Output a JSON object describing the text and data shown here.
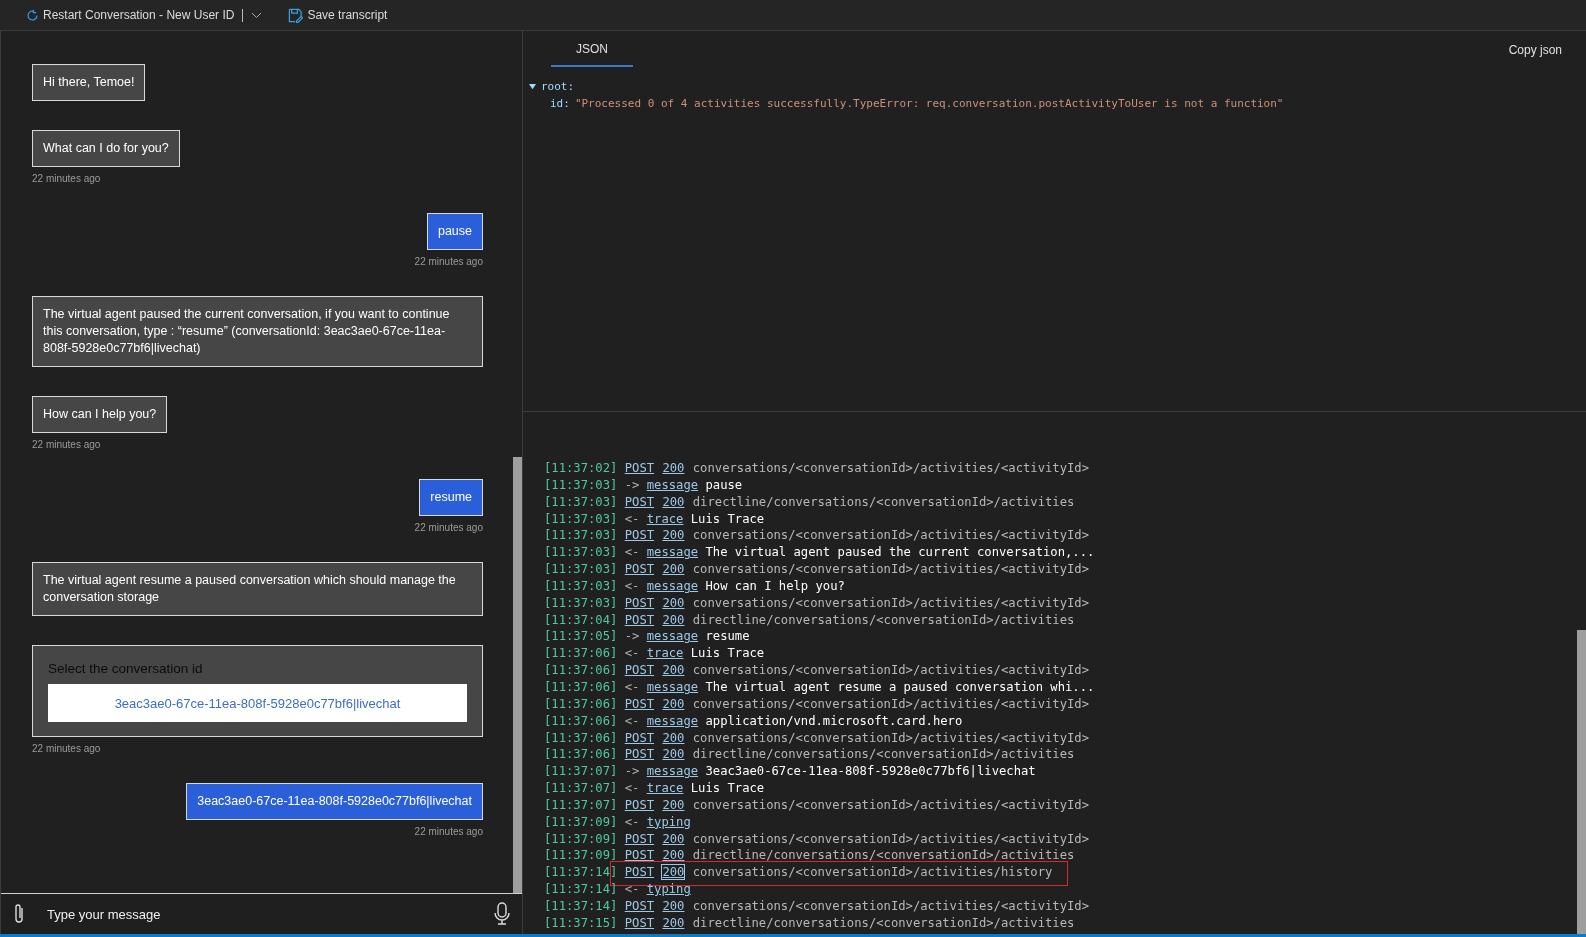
{
  "toolbar": {
    "restart_button": "Restart Conversation - New User ID",
    "save_button": "Save transcript"
  },
  "chat": {
    "messages": [
      {
        "outgoing": false,
        "kind": "text",
        "text": "Hi there, Temoe!"
      },
      {
        "outgoing": false,
        "kind": "text",
        "text": "What can I do for you?",
        "timestamp": "22 minutes ago"
      },
      {
        "outgoing": true,
        "kind": "text",
        "text": "pause",
        "timestamp": "22 minutes ago"
      },
      {
        "outgoing": false,
        "kind": "text",
        "text": "The virtual agent paused the current conversation, if you want to continue this conversation, type : “resume” (conversationId: 3eac3ae0-67ce-11ea-808f-5928e0c77bf6|livechat)"
      },
      {
        "outgoing": false,
        "kind": "text",
        "text": "How can I help you?",
        "timestamp": "22 minutes ago"
      },
      {
        "outgoing": true,
        "kind": "text",
        "text": "resume",
        "timestamp": "22 minutes ago"
      },
      {
        "outgoing": false,
        "kind": "text",
        "text": "The virtual agent resume a paused conversation which should manage the conversation storage"
      },
      {
        "outgoing": false,
        "kind": "card",
        "title": "Select the conversation id",
        "button": "3eac3ae0-67ce-11ea-808f-5928e0c77bf6|livechat",
        "timestamp": "22 minutes ago"
      },
      {
        "outgoing": true,
        "kind": "text",
        "text": "3eac3ae0-67ce-11ea-808f-5928e0c77bf6|livechat",
        "timestamp": "22 minutes ago"
      }
    ],
    "input": {
      "placeholder": "Type your message"
    }
  },
  "inspector": {
    "tabs": [
      {
        "label": "JSON",
        "selected": true
      }
    ],
    "copy_button": "Copy json",
    "tree": {
      "root_label": "root:",
      "expanded": true,
      "fields": [
        {
          "key": "id:",
          "value": "\"Processed 0 of 4 activities successfully.TypeError: req.conversation.postActivityToUser is not a function\""
        }
      ]
    }
  },
  "log": [
    {
      "kind": "post",
      "time": "[11:37:02]",
      "method": "POST",
      "status": "200",
      "path": "conversations/<conversationId>/activities/<activityId>",
      "highlighted": false
    },
    {
      "kind": "activity",
      "time": "[11:37:03]",
      "direction": "->",
      "type": "message",
      "text": "pause"
    },
    {
      "kind": "post",
      "time": "[11:37:03]",
      "method": "POST",
      "status": "200",
      "path": "directline/conversations/<conversationId>/activities",
      "highlighted": false
    },
    {
      "kind": "activity",
      "time": "[11:37:03]",
      "direction": "<-",
      "type": "trace",
      "text": "Luis Trace"
    },
    {
      "kind": "post",
      "time": "[11:37:03]",
      "method": "POST",
      "status": "200",
      "path": "conversations/<conversationId>/activities/<activityId>",
      "highlighted": false
    },
    {
      "kind": "activity",
      "time": "[11:37:03]",
      "direction": "<-",
      "type": "message",
      "text": "The virtual agent paused the current conversation,..."
    },
    {
      "kind": "post",
      "time": "[11:37:03]",
      "method": "POST",
      "status": "200",
      "path": "conversations/<conversationId>/activities/<activityId>",
      "highlighted": false
    },
    {
      "kind": "activity",
      "time": "[11:37:03]",
      "direction": "<-",
      "type": "message",
      "text": "How can I help you?"
    },
    {
      "kind": "post",
      "time": "[11:37:03]",
      "method": "POST",
      "status": "200",
      "path": "conversations/<conversationId>/activities/<activityId>",
      "highlighted": false
    },
    {
      "kind": "post",
      "time": "[11:37:04]",
      "method": "POST",
      "status": "200",
      "path": "directline/conversations/<conversationId>/activities",
      "highlighted": false
    },
    {
      "kind": "activity",
      "time": "[11:37:05]",
      "direction": "->",
      "type": "message",
      "text": "resume"
    },
    {
      "kind": "activity",
      "time": "[11:37:06]",
      "direction": "<-",
      "type": "trace",
      "text": "Luis Trace"
    },
    {
      "kind": "post",
      "time": "[11:37:06]",
      "method": "POST",
      "status": "200",
      "path": "conversations/<conversationId>/activities/<activityId>",
      "highlighted": false
    },
    {
      "kind": "activity",
      "time": "[11:37:06]",
      "direction": "<-",
      "type": "message",
      "text": "The virtual agent resume a paused conversation whi..."
    },
    {
      "kind": "post",
      "time": "[11:37:06]",
      "method": "POST",
      "status": "200",
      "path": "conversations/<conversationId>/activities/<activityId>",
      "highlighted": false
    },
    {
      "kind": "activity",
      "time": "[11:37:06]",
      "direction": "<-",
      "type": "message",
      "text": "application/vnd.microsoft.card.hero"
    },
    {
      "kind": "post",
      "time": "[11:37:06]",
      "method": "POST",
      "status": "200",
      "path": "conversations/<conversationId>/activities/<activityId>",
      "highlighted": false
    },
    {
      "kind": "post",
      "time": "[11:37:06]",
      "method": "POST",
      "status": "200",
      "path": "directline/conversations/<conversationId>/activities",
      "highlighted": false
    },
    {
      "kind": "activity",
      "time": "[11:37:07]",
      "direction": "->",
      "type": "message",
      "text": "3eac3ae0-67ce-11ea-808f-5928e0c77bf6|livechat"
    },
    {
      "kind": "activity",
      "time": "[11:37:07]",
      "direction": "<-",
      "type": "trace",
      "text": "Luis Trace"
    },
    {
      "kind": "post",
      "time": "[11:37:07]",
      "method": "POST",
      "status": "200",
      "path": "conversations/<conversationId>/activities/<activityId>",
      "highlighted": false
    },
    {
      "kind": "activity",
      "time": "[11:37:09]",
      "direction": "<-",
      "type": "typing"
    },
    {
      "kind": "post",
      "time": "[11:37:09]",
      "method": "POST",
      "status": "200",
      "path": "conversations/<conversationId>/activities/<activityId>",
      "highlighted": false
    },
    {
      "kind": "post",
      "time": "[11:37:09]",
      "method": "POST",
      "status": "200",
      "path": "directline/conversations/<conversationId>/activities",
      "highlighted": false
    },
    {
      "kind": "post",
      "time": "[11:37:14]",
      "method": "POST",
      "status": "200",
      "path": "conversations/<conversationId>/activities/history",
      "highlighted": true
    },
    {
      "kind": "activity",
      "time": "[11:37:14]",
      "direction": "<-",
      "type": "typing"
    },
    {
      "kind": "post",
      "time": "[11:37:14]",
      "method": "POST",
      "status": "200",
      "path": "conversations/<conversationId>/activities/<activityId>",
      "highlighted": false
    },
    {
      "kind": "post",
      "time": "[11:37:15]",
      "method": "POST",
      "status": "200",
      "path": "directline/conversations/<conversationId>/activities",
      "highlighted": false
    }
  ]
}
